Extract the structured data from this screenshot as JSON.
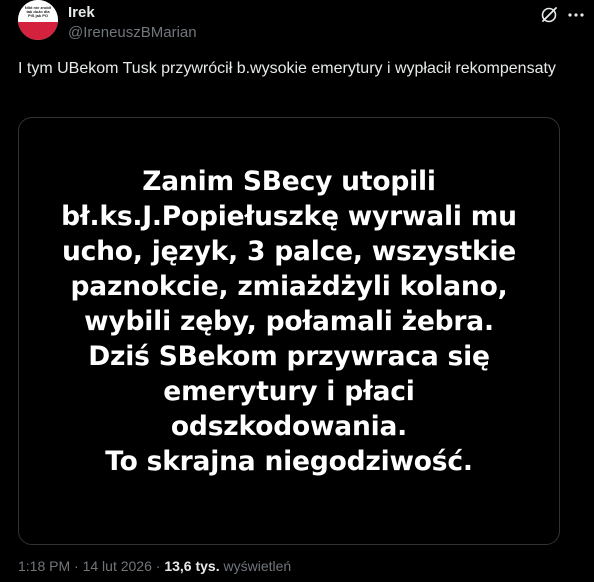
{
  "author": {
    "display_name": "Irek",
    "handle": "@IreneuszBMarian",
    "avatar_text": "Nikt nie zrobił tak dużo dla PiS jak PO"
  },
  "icons": {
    "grok": "grok-icon",
    "more": "more-icon"
  },
  "tweet": {
    "text": "I tym UBekom Tusk przywrócił b.wysokie emerytury i wypłacił rekompensaty"
  },
  "image_text": {
    "lines": [
      "Zanim SBecy utopili",
      "bł.ks.J.Popiełuszkę wyrwali mu",
      "ucho, język, 3 palce, wszystkie",
      "paznokcie, zmiażdżyli kolano,",
      "wybili zęby, połamali żebra.",
      "Dziś SBekom przywraca się",
      "emerytury i płaci",
      "odszkodowania.",
      "To skrajna niegodziwość."
    ]
  },
  "meta": {
    "time": "1:18 PM",
    "separator": "·",
    "date": "14 lut 2026",
    "views_count": "13,6 tys.",
    "views_label": "wyświetleń"
  },
  "colors": {
    "background": "#000000",
    "text_primary": "#e7e9ea",
    "text_secondary": "#71767b",
    "border": "#2f3336"
  }
}
